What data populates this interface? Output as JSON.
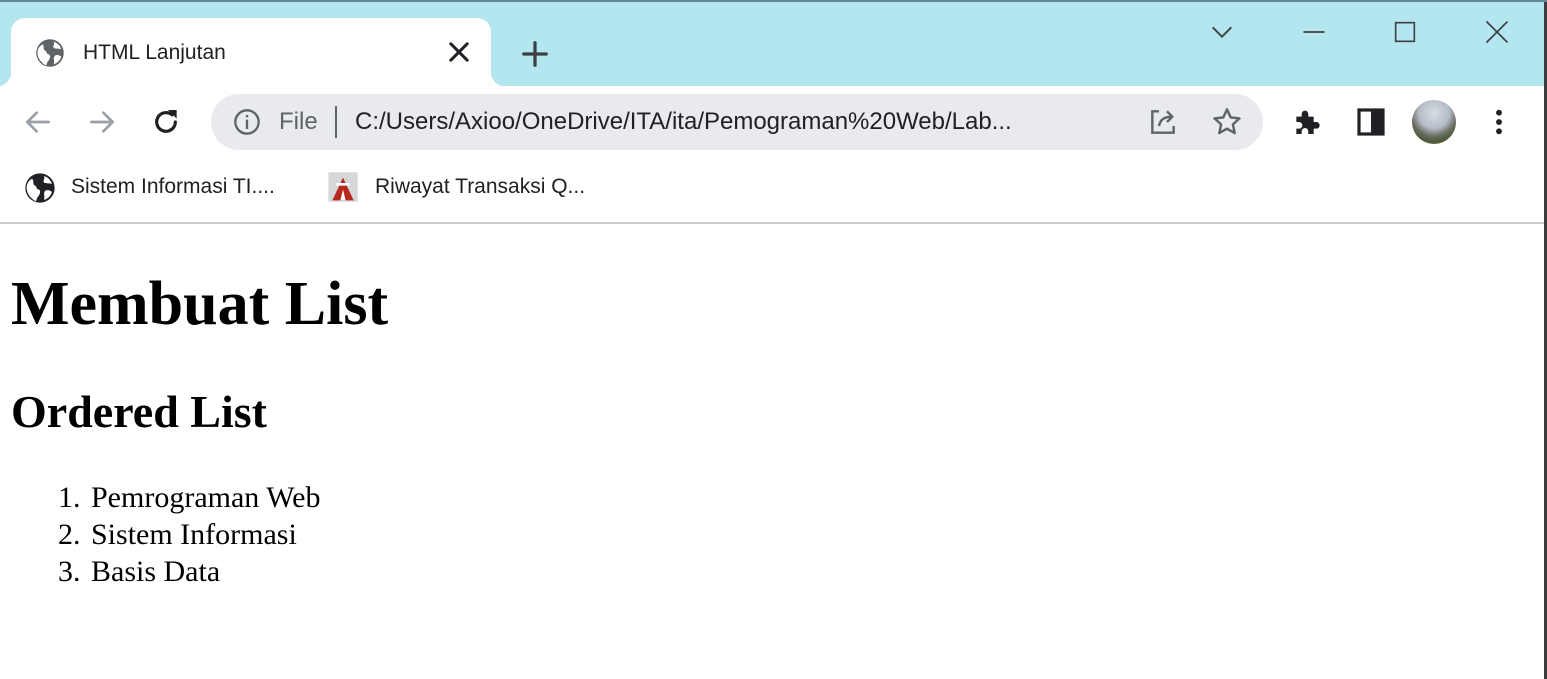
{
  "browser": {
    "tab": {
      "title": "HTML Lanjutan"
    },
    "omnibox": {
      "scheme_label": "File",
      "url": "C:/Users/Axioo/OneDrive/ITA/ita/Pemograman%20Web/Lab..."
    },
    "bookmarks": [
      {
        "label": "Sistem Informasi TI....",
        "icon": "globe-icon"
      },
      {
        "label": "Riwayat Transaksi Q...",
        "icon": "site-favicon"
      }
    ]
  },
  "page": {
    "heading": "Membuat List",
    "subheading": "Ordered List",
    "list": [
      {
        "number": "1.",
        "text": "Pemrograman Web"
      },
      {
        "number": "2.",
        "text": "Sistem Informasi"
      },
      {
        "number": "3.",
        "text": "Basis Data"
      }
    ]
  },
  "colors": {
    "tabstrip": "#b4e6f0",
    "omnibox": "#e8eaed",
    "text": "#202124",
    "icon": "#5f6368"
  }
}
